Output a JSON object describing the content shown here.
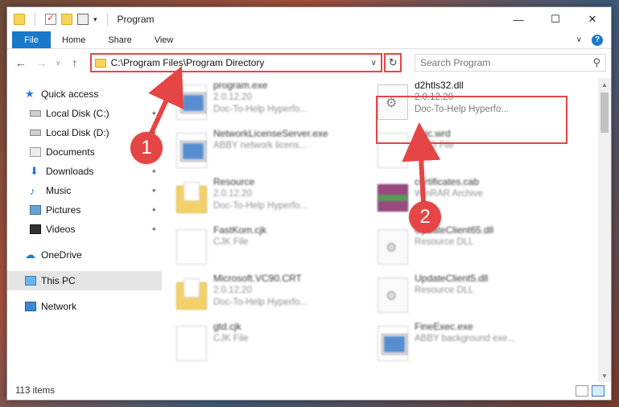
{
  "window": {
    "title": "Program"
  },
  "titlebar": {
    "minimize": "—",
    "maximize": "☐",
    "close": "✕"
  },
  "ribbon": {
    "file_tab": "File",
    "tabs": [
      "Home",
      "Share",
      "View"
    ],
    "help": "?"
  },
  "address": {
    "path": "C:\\Program Files\\Program Directory",
    "search_placeholder": "Search Program"
  },
  "nav": {
    "items": [
      {
        "label": "Quick access",
        "icon": "star-icon"
      },
      {
        "label": "Local Disk (C:)",
        "icon": "disk-icon"
      },
      {
        "label": "Local Disk (D:)",
        "icon": "disk-icon"
      },
      {
        "label": "Documents",
        "icon": "documents-icon"
      },
      {
        "label": "Downloads",
        "icon": "downloads-icon"
      },
      {
        "label": "Music",
        "icon": "music-icon"
      },
      {
        "label": "Pictures",
        "icon": "pictures-icon"
      },
      {
        "label": "Videos",
        "icon": "videos-icon"
      },
      {
        "label": "OneDrive",
        "icon": "cloud-icon"
      },
      {
        "label": "This PC",
        "icon": "pc-icon"
      },
      {
        "label": "Network",
        "icon": "network-icon"
      }
    ]
  },
  "files": [
    {
      "name": "program.exe",
      "sub1": "2.0.12.20",
      "sub2": "Doc-To-Help Hyperfo...",
      "icon": "exe-icon"
    },
    {
      "name": "d2htls32.dll",
      "sub1": "2.0.12.20",
      "sub2": "Doc-To-Help Hyperfo...",
      "icon": "dll-icon"
    },
    {
      "name": "NetworkLicenseServer.exe",
      "sub1": "ABBY network licens...",
      "sub2": "",
      "icon": "exe-icon"
    },
    {
      "name": "abic.wrd",
      "sub1": "WRD File",
      "sub2": "",
      "icon": "file-icon"
    },
    {
      "name": "Resource",
      "sub1": "2.0.12.20",
      "sub2": "Doc-To-Help Hyperfo...",
      "icon": "folder-icon"
    },
    {
      "name": "certificates.cab",
      "sub1": "WinRAR Archive",
      "sub2": "",
      "icon": "archive-icon"
    },
    {
      "name": "FastKom.cjk",
      "sub1": "CJK File",
      "sub2": "",
      "icon": "file-icon"
    },
    {
      "name": "UpdateClient65.dll",
      "sub1": "Resource DLL",
      "sub2": "",
      "icon": "dll-icon"
    },
    {
      "name": "Microsoft.VC90.CRT",
      "sub1": "2.0.12.20",
      "sub2": "Doc-To-Help Hyperfo...",
      "icon": "folder-icon"
    },
    {
      "name": "UpdateClient5.dll",
      "sub1": "Resource DLL",
      "sub2": "",
      "icon": "dll-icon"
    },
    {
      "name": "gtd.cjk",
      "sub1": "CJK File",
      "sub2": "",
      "icon": "file-icon"
    },
    {
      "name": "FineExec.exe",
      "sub1": "ABBY background exe...",
      "sub2": "",
      "icon": "exe-icon"
    }
  ],
  "callouts": [
    "1",
    "2"
  ],
  "status": {
    "item_count": "113 items"
  },
  "colors": {
    "accent": "#1979ca",
    "highlight": "#e64545"
  }
}
